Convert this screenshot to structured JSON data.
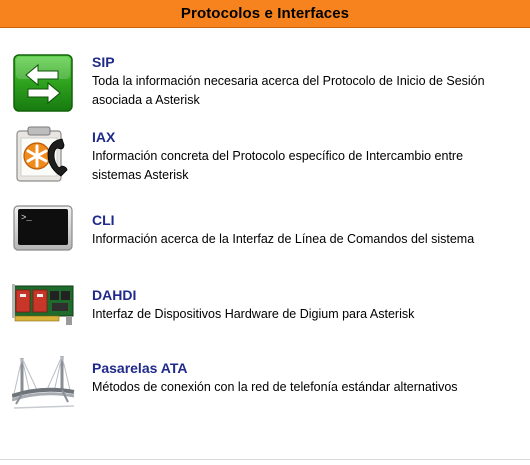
{
  "header": {
    "title": "Protocolos e Interfaces"
  },
  "items": [
    {
      "icon": "sip-arrows-icon",
      "title": "SIP",
      "description": "Toda la información necesaria acerca del Protocolo de Inicio de Sesión asociada a Asterisk"
    },
    {
      "icon": "iax-phone-icon",
      "title": "IAX",
      "description": "Información concreta del Protocolo específico de Intercambio entre sistemas Asterisk"
    },
    {
      "icon": "cli-terminal-icon",
      "title": "CLI",
      "description": "Información acerca de la Interfaz de Línea de Comandos del sistema"
    },
    {
      "icon": "dahdi-card-icon",
      "title": "DAHDI",
      "description": "Interfaz de Dispositivos Hardware de Digium para Asterisk"
    },
    {
      "icon": "bridge-icon",
      "title": "Pasarelas ATA",
      "description": "Métodos de conexión con la red de telefonía estándar alternativos"
    }
  ],
  "colors": {
    "header_bg": "#f7831f",
    "title_link": "#1f2a8a"
  }
}
